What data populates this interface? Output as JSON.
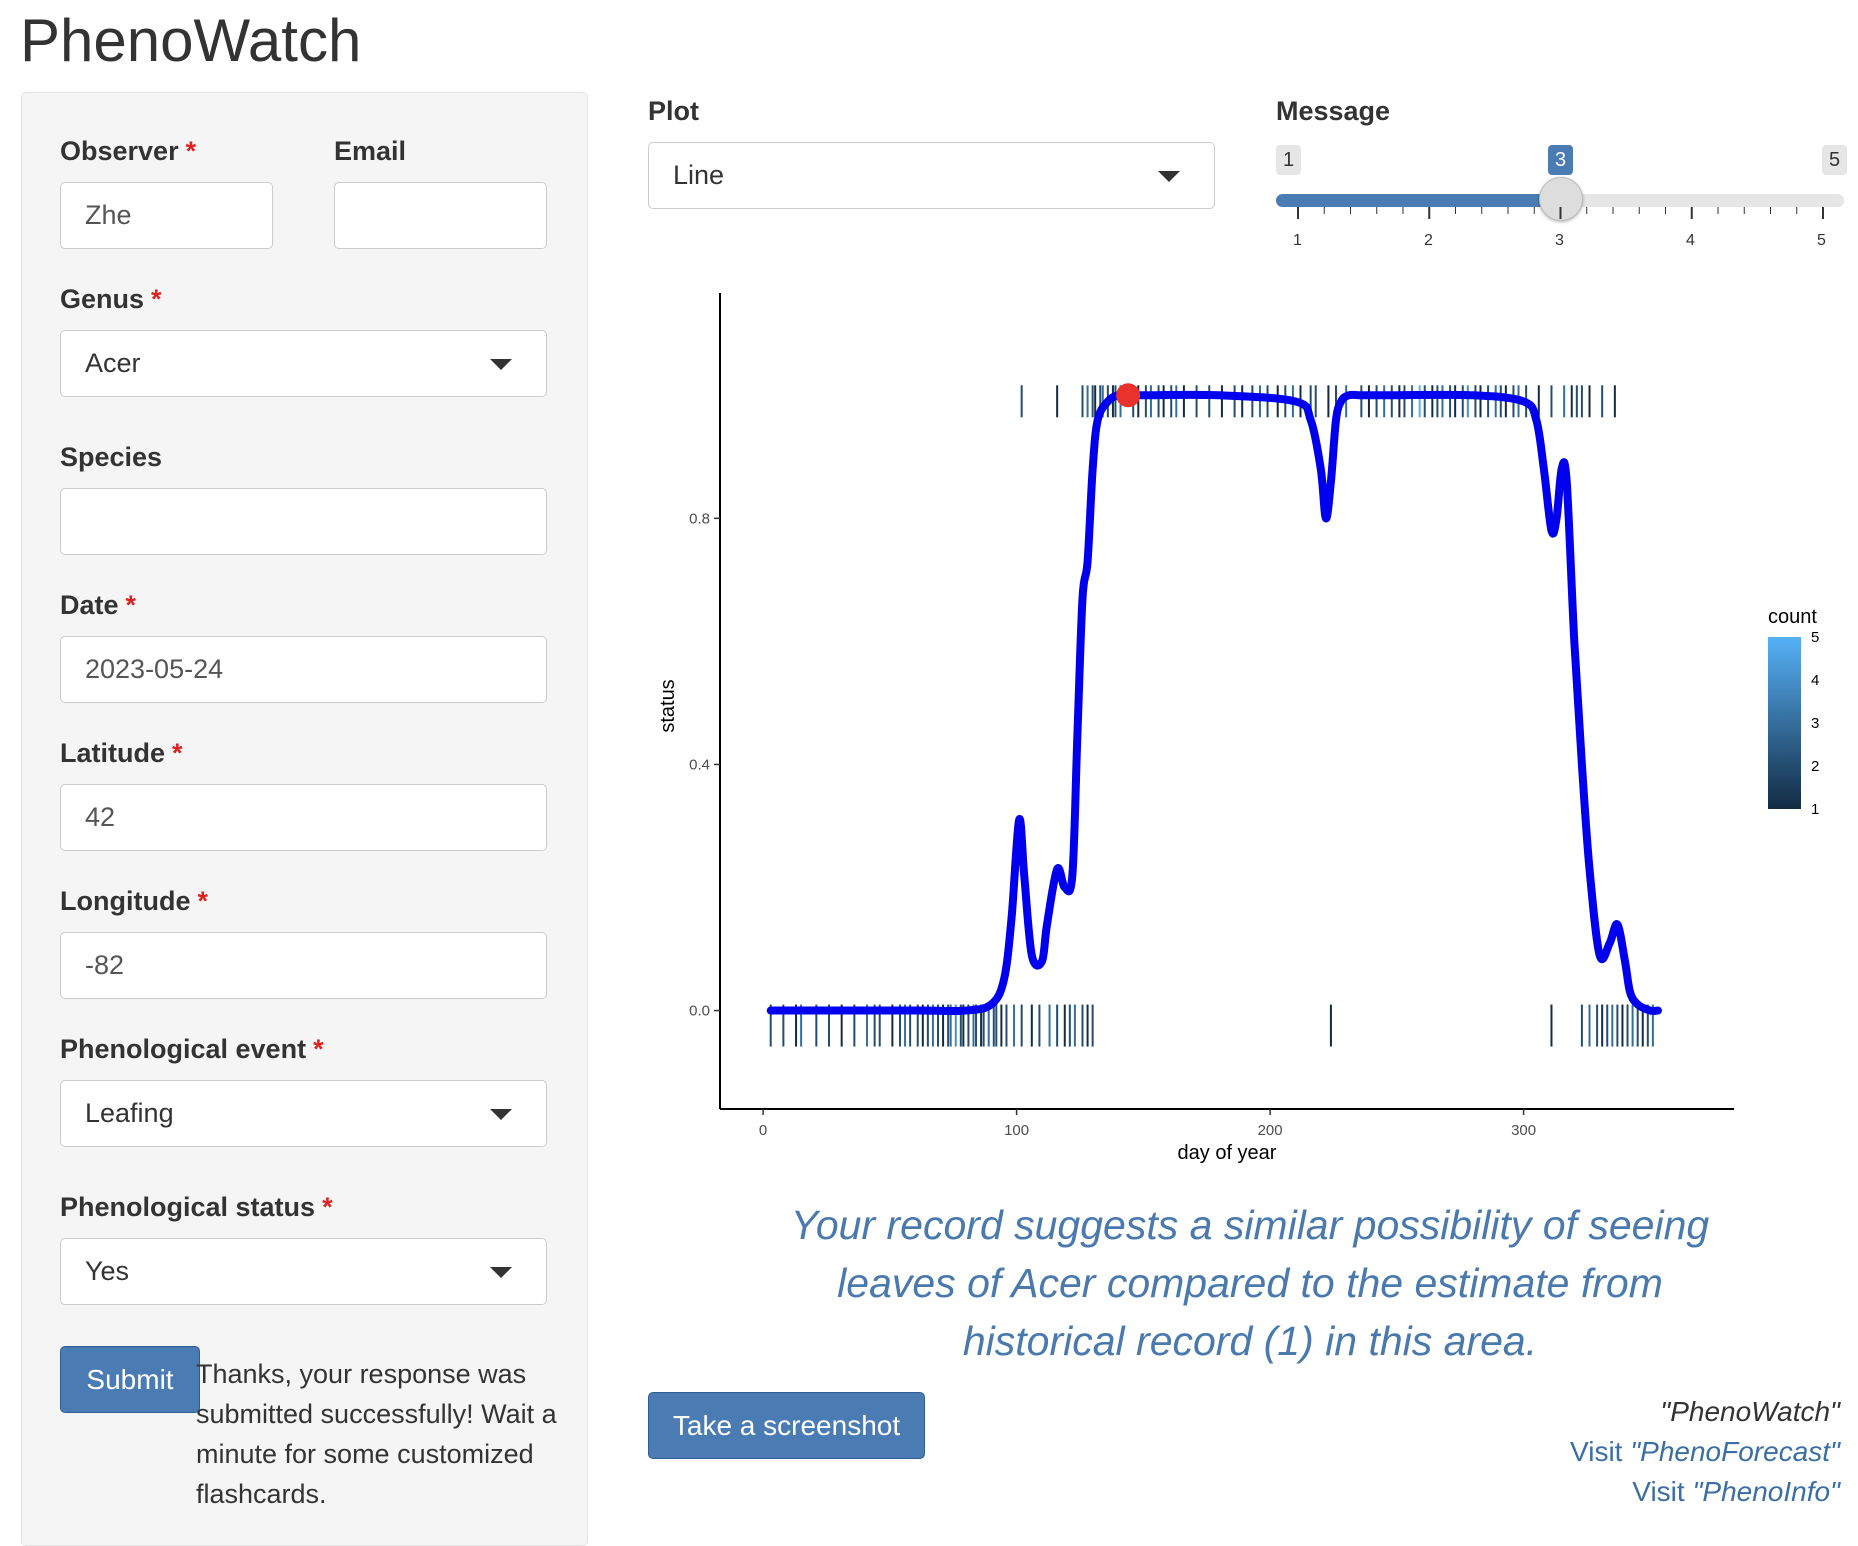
{
  "app": {
    "title": "PhenoWatch"
  },
  "form": {
    "observer": {
      "label": "Observer",
      "value": "Zhe"
    },
    "email": {
      "label": "Email",
      "value": ""
    },
    "genus": {
      "label": "Genus",
      "value": "Acer"
    },
    "species": {
      "label": "Species",
      "value": ""
    },
    "date": {
      "label": "Date",
      "value": "2023-05-24"
    },
    "latitude": {
      "label": "Latitude",
      "value": "42"
    },
    "longitude": {
      "label": "Longitude",
      "value": "-82"
    },
    "event": {
      "label": "Phenological event",
      "value": "Leafing"
    },
    "status": {
      "label": "Phenological status",
      "value": "Yes"
    },
    "required_marker": "*",
    "submit_label": "Submit",
    "submit_message": "Thanks, your response was submitted successfully! Wait a minute for some customized flashcards."
  },
  "controls": {
    "plot": {
      "label": "Plot",
      "value": "Line"
    },
    "message": {
      "label": "Message",
      "min": "1",
      "max": "5",
      "value": "3",
      "ticks": [
        "1",
        "2",
        "3",
        "4",
        "5"
      ]
    }
  },
  "chart_data": {
    "type": "line",
    "xlabel": "day of year",
    "ylabel": "status",
    "xlim": [
      -17,
      383
    ],
    "ylim": [
      -0.16,
      1.15
    ],
    "x_ticks": [
      0,
      100,
      200,
      300
    ],
    "y_ticks": [
      0.0,
      0.4,
      0.8
    ],
    "y_tick_labels": [
      "0.0",
      "0.4",
      "0.8"
    ],
    "series": [
      {
        "color": "#0000ee",
        "x": [
          3,
          60,
          80,
          90,
          95,
          98,
          101,
          103,
          106,
          110,
          112,
          116,
          119,
          122,
          124,
          126,
          128,
          130,
          132,
          136,
          140,
          144,
          150,
          180,
          210,
          216,
          220,
          222,
          224,
          226,
          228,
          231,
          236,
          245,
          280,
          300,
          305,
          308,
          311,
          313,
          315,
          317,
          320,
          323,
          326,
          330,
          334,
          337,
          340,
          342,
          345,
          350,
          353
        ],
        "y": [
          0.0,
          0.0,
          0.0,
          0.01,
          0.05,
          0.15,
          0.31,
          0.22,
          0.09,
          0.08,
          0.14,
          0.23,
          0.2,
          0.22,
          0.45,
          0.67,
          0.73,
          0.88,
          0.96,
          0.99,
          1.0,
          1.0,
          1.0,
          1.0,
          0.99,
          0.96,
          0.88,
          0.8,
          0.86,
          0.96,
          0.99,
          1.0,
          1.0,
          1.0,
          1.0,
          0.99,
          0.96,
          0.88,
          0.78,
          0.8,
          0.88,
          0.86,
          0.6,
          0.4,
          0.23,
          0.09,
          0.11,
          0.14,
          0.08,
          0.03,
          0.01,
          0.0,
          0.0
        ]
      }
    ],
    "highlight_point": {
      "x": 144,
      "y": 1.0,
      "color": "#e8322b"
    },
    "rug_top": {
      "y": 1.0,
      "x": [
        102,
        116,
        126,
        128,
        130,
        131,
        133,
        134,
        136,
        138,
        139,
        141,
        146,
        148,
        151,
        153,
        156,
        158,
        161,
        163,
        166,
        171,
        176,
        181,
        186,
        189,
        193,
        196,
        199,
        203,
        206,
        209,
        212,
        216,
        218,
        223,
        226,
        230,
        236,
        239,
        242,
        245,
        248,
        251,
        253,
        256,
        259,
        261,
        264,
        266,
        268,
        271,
        273,
        276,
        278,
        281,
        283,
        286,
        289,
        291,
        293,
        296,
        298,
        301,
        306,
        311,
        316,
        319,
        321,
        323,
        326,
        331,
        336
      ],
      "count": [
        2,
        1,
        2,
        3,
        2,
        1,
        2,
        3,
        2,
        1,
        2,
        3,
        2,
        1,
        2,
        3,
        2,
        1,
        2,
        3,
        1,
        2,
        2,
        1,
        2,
        1,
        2,
        3,
        2,
        1,
        2,
        3,
        1,
        2,
        2,
        1,
        2,
        3,
        2,
        1,
        2,
        3,
        2,
        1,
        2,
        3,
        5,
        2,
        1,
        2,
        3,
        2,
        1,
        2,
        4,
        2,
        1,
        2,
        3,
        2,
        1,
        2,
        3,
        2,
        1,
        2,
        3,
        1,
        2,
        2,
        1,
        2,
        1
      ]
    },
    "rug_bottom": {
      "y": 0.0,
      "x": [
        3,
        8,
        13,
        15,
        21,
        26,
        31,
        36,
        41,
        44,
        46,
        51,
        54,
        56,
        58,
        61,
        63,
        65,
        67,
        69,
        71,
        73,
        74,
        76,
        78,
        79,
        81,
        83,
        84,
        86,
        87,
        89,
        91,
        92,
        94,
        96,
        99,
        102,
        106,
        109,
        113,
        116,
        119,
        121,
        123,
        126,
        128,
        130,
        224,
        311,
        323,
        326,
        329,
        331,
        333,
        335,
        337,
        339,
        341,
        343,
        345,
        347,
        349,
        351
      ],
      "count": [
        2,
        2,
        1,
        3,
        2,
        2,
        1,
        2,
        3,
        2,
        2,
        1,
        2,
        3,
        2,
        2,
        1,
        2,
        3,
        2,
        1,
        2,
        3,
        4,
        2,
        1,
        2,
        3,
        2,
        1,
        2,
        3,
        2,
        2,
        1,
        2,
        3,
        2,
        1,
        2,
        3,
        2,
        1,
        2,
        3,
        2,
        1,
        2,
        1,
        1,
        2,
        3,
        2,
        1,
        2,
        3,
        2,
        1,
        2,
        3,
        2,
        1,
        2,
        3
      ]
    },
    "legend": {
      "title": "count",
      "labels": [
        "5",
        "4",
        "3",
        "2",
        "1"
      ],
      "color_low": "#132b43",
      "color_high": "#56b1f7",
      "position": "right"
    }
  },
  "feedback": {
    "text": "Your record suggests a similar possibility of seeing leaves of Acer compared to the estimate from historical record (1) in this area."
  },
  "screenshot_button": {
    "label": "Take a screenshot"
  },
  "footer": {
    "app_name": "\"PhenoWatch\"",
    "link1_prefix": "Visit",
    "link1_name": "\"PhenoForecast\"",
    "link2_prefix": "Visit",
    "link2_name": "\"PhenoInfo\""
  }
}
